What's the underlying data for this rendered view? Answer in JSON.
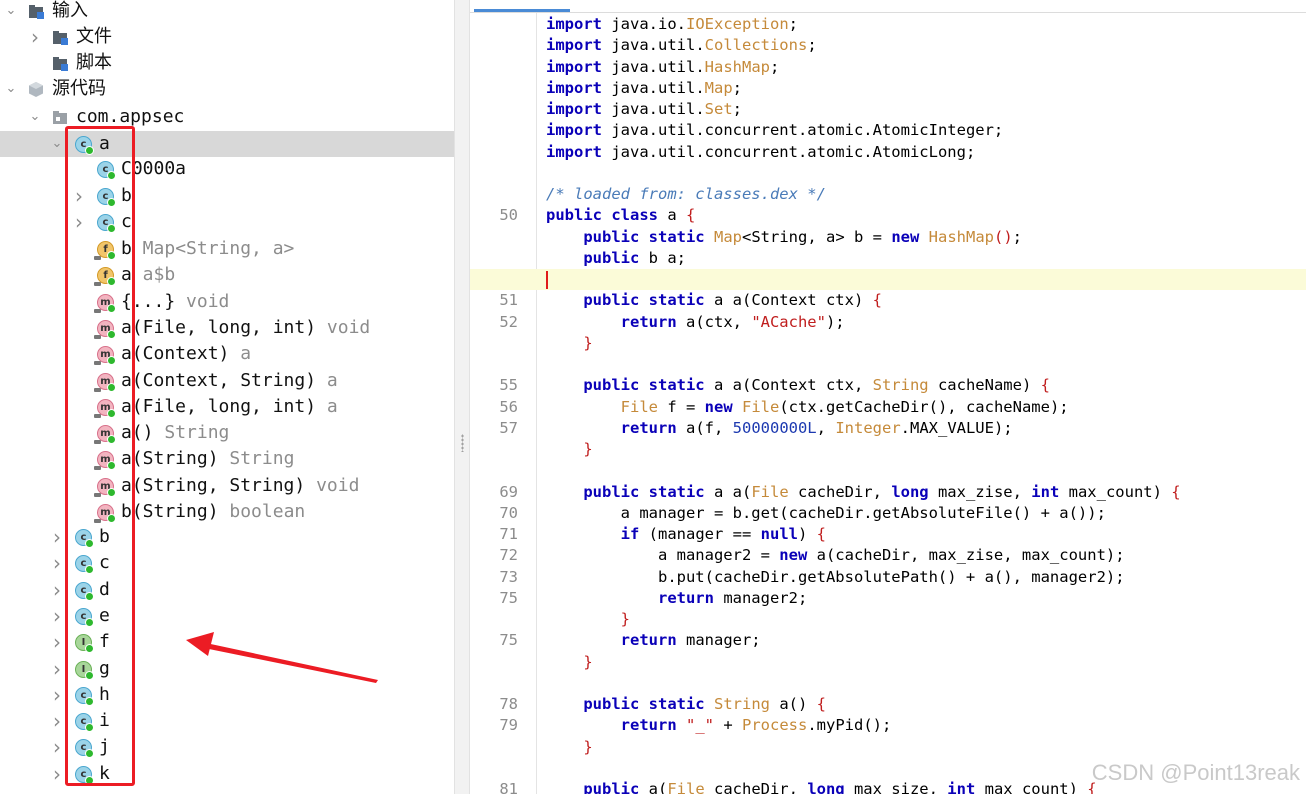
{
  "tree": {
    "input_label": "输入",
    "files_label": "文件",
    "scripts_label": "脚本",
    "source_label": "源代码",
    "package_label": "com.appsec",
    "selected_class": "a",
    "inner_class": "C0000a",
    "inner_b": "b",
    "inner_c": "c",
    "members": [
      {
        "name": "b",
        "detail": " Map<String, a>",
        "kind": "f"
      },
      {
        "name": "a",
        "detail": " a$b",
        "kind": "f"
      },
      {
        "name": "{...}",
        "detail": " void",
        "kind": "m"
      },
      {
        "name": "a(File, long, int)",
        "detail": " void",
        "kind": "m"
      },
      {
        "name": "a(Context)",
        "detail": " a",
        "kind": "m"
      },
      {
        "name": "a(Context, String)",
        "detail": " a",
        "kind": "m"
      },
      {
        "name": "a(File, long, int)",
        "detail": " a",
        "kind": "m"
      },
      {
        "name": "a()",
        "detail": " String",
        "kind": "m"
      },
      {
        "name": "a(String)",
        "detail": " String",
        "kind": "m"
      },
      {
        "name": "a(String, String)",
        "detail": " void",
        "kind": "m"
      },
      {
        "name": "b(String)",
        "detail": " boolean",
        "kind": "m"
      }
    ],
    "classes": [
      {
        "name": "b",
        "kind": "c"
      },
      {
        "name": "c",
        "kind": "c"
      },
      {
        "name": "d",
        "kind": "c"
      },
      {
        "name": "e",
        "kind": "c"
      },
      {
        "name": "f",
        "kind": "i"
      },
      {
        "name": "g",
        "kind": "i"
      },
      {
        "name": "h",
        "kind": "c"
      },
      {
        "name": "i",
        "kind": "c"
      },
      {
        "name": "j",
        "kind": "c"
      },
      {
        "name": "k",
        "kind": "c"
      }
    ]
  },
  "editor": {
    "lines": [
      {
        "n": "",
        "t": [
          [
            "kw",
            "import"
          ],
          [
            "pl",
            " java.io."
          ],
          [
            "ty",
            "IOException"
          ],
          [
            "pl",
            ";"
          ]
        ]
      },
      {
        "n": "",
        "t": [
          [
            "kw",
            "import"
          ],
          [
            "pl",
            " java.util."
          ],
          [
            "ty",
            "Collections"
          ],
          [
            "pl",
            ";"
          ]
        ]
      },
      {
        "n": "",
        "t": [
          [
            "kw",
            "import"
          ],
          [
            "pl",
            " java.util."
          ],
          [
            "ty",
            "HashMap"
          ],
          [
            "pl",
            ";"
          ]
        ]
      },
      {
        "n": "",
        "t": [
          [
            "kw",
            "import"
          ],
          [
            "pl",
            " java.util."
          ],
          [
            "ty",
            "Map"
          ],
          [
            "pl",
            ";"
          ]
        ]
      },
      {
        "n": "",
        "t": [
          [
            "kw",
            "import"
          ],
          [
            "pl",
            " java.util."
          ],
          [
            "ty",
            "Set"
          ],
          [
            "pl",
            ";"
          ]
        ]
      },
      {
        "n": "",
        "t": [
          [
            "kw",
            "import"
          ],
          [
            "pl",
            " java.util.concurrent.atomic.AtomicInteger;"
          ]
        ]
      },
      {
        "n": "",
        "t": [
          [
            "kw",
            "import"
          ],
          [
            "pl",
            " java.util.concurrent.atomic.AtomicLong;"
          ]
        ]
      },
      {
        "n": "",
        "t": []
      },
      {
        "n": "",
        "t": [
          [
            "cm",
            "/* loaded from: classes.dex */"
          ]
        ]
      },
      {
        "n": "50",
        "t": [
          [
            "kw",
            "public class"
          ],
          [
            "pl",
            " a "
          ],
          [
            "pa",
            "{"
          ]
        ]
      },
      {
        "n": "",
        "t": [
          [
            "pl",
            "    "
          ],
          [
            "kw",
            "public static"
          ],
          [
            "pl",
            " "
          ],
          [
            "ty",
            "Map"
          ],
          [
            "pl",
            "<String, a> b = "
          ],
          [
            "kw",
            "new"
          ],
          [
            "pl",
            " "
          ],
          [
            "ty",
            "HashMap"
          ],
          [
            "pa",
            "()"
          ],
          [
            "pl",
            ";"
          ]
        ]
      },
      {
        "n": "",
        "t": [
          [
            "pl",
            "    "
          ],
          [
            "kw",
            "public"
          ],
          [
            "pl",
            " b a;"
          ]
        ]
      },
      {
        "n": "",
        "t": [],
        "cur": true
      },
      {
        "n": "51",
        "t": [
          [
            "pl",
            "    "
          ],
          [
            "kw",
            "public static"
          ],
          [
            "pl",
            " a a(Context ctx) "
          ],
          [
            "pa",
            "{"
          ]
        ]
      },
      {
        "n": "52",
        "t": [
          [
            "pl",
            "        "
          ],
          [
            "kw",
            "return"
          ],
          [
            "pl",
            " a(ctx, "
          ],
          [
            "st",
            "\"ACache\""
          ],
          [
            "pl",
            ");"
          ]
        ]
      },
      {
        "n": "",
        "t": [
          [
            "pl",
            "    "
          ],
          [
            "pa",
            "}"
          ]
        ]
      },
      {
        "n": "",
        "t": []
      },
      {
        "n": "55",
        "t": [
          [
            "pl",
            "    "
          ],
          [
            "kw",
            "public static"
          ],
          [
            "pl",
            " a a(Context ctx, "
          ],
          [
            "ty",
            "String"
          ],
          [
            "pl",
            " cacheName) "
          ],
          [
            "pa",
            "{"
          ]
        ]
      },
      {
        "n": "56",
        "t": [
          [
            "pl",
            "        "
          ],
          [
            "ty",
            "File"
          ],
          [
            "pl",
            " f = "
          ],
          [
            "kw",
            "new"
          ],
          [
            "pl",
            " "
          ],
          [
            "ty",
            "File"
          ],
          [
            "pl",
            "(ctx.getCacheDir(), cacheName);"
          ]
        ]
      },
      {
        "n": "57",
        "t": [
          [
            "pl",
            "        "
          ],
          [
            "kw",
            "return"
          ],
          [
            "pl",
            " a(f, "
          ],
          [
            "nm",
            "50000000L"
          ],
          [
            "pl",
            ", "
          ],
          [
            "ty",
            "Integer"
          ],
          [
            "pl",
            ".MAX_VALUE);"
          ]
        ]
      },
      {
        "n": "",
        "t": [
          [
            "pl",
            "    "
          ],
          [
            "pa",
            "}"
          ]
        ]
      },
      {
        "n": "",
        "t": []
      },
      {
        "n": "69",
        "t": [
          [
            "pl",
            "    "
          ],
          [
            "kw",
            "public static"
          ],
          [
            "pl",
            " a a("
          ],
          [
            "ty",
            "File"
          ],
          [
            "pl",
            " cacheDir, "
          ],
          [
            "kw",
            "long"
          ],
          [
            "pl",
            " max_zise, "
          ],
          [
            "kw",
            "int"
          ],
          [
            "pl",
            " max_count) "
          ],
          [
            "pa",
            "{"
          ]
        ]
      },
      {
        "n": "70",
        "t": [
          [
            "pl",
            "        a manager = b.get(cacheDir.getAbsoluteFile() + a());"
          ]
        ]
      },
      {
        "n": "71",
        "t": [
          [
            "pl",
            "        "
          ],
          [
            "kw",
            "if"
          ],
          [
            "pl",
            " (manager == "
          ],
          [
            "kw",
            "null"
          ],
          [
            "pl",
            ") "
          ],
          [
            "pa",
            "{"
          ]
        ]
      },
      {
        "n": "72",
        "t": [
          [
            "pl",
            "            a manager2 = "
          ],
          [
            "kw",
            "new"
          ],
          [
            "pl",
            " a(cacheDir, max_zise, max_count);"
          ]
        ]
      },
      {
        "n": "73",
        "t": [
          [
            "pl",
            "            b.put(cacheDir.getAbsolutePath() + a(), manager2);"
          ]
        ]
      },
      {
        "n": "75",
        "t": [
          [
            "pl",
            "            "
          ],
          [
            "kw",
            "return"
          ],
          [
            "pl",
            " manager2;"
          ]
        ]
      },
      {
        "n": "",
        "t": [
          [
            "pl",
            "        "
          ],
          [
            "pa",
            "}"
          ]
        ]
      },
      {
        "n": "75",
        "t": [
          [
            "pl",
            "        "
          ],
          [
            "kw",
            "return"
          ],
          [
            "pl",
            " manager;"
          ]
        ]
      },
      {
        "n": "",
        "t": [
          [
            "pl",
            "    "
          ],
          [
            "pa",
            "}"
          ]
        ]
      },
      {
        "n": "",
        "t": []
      },
      {
        "n": "78",
        "t": [
          [
            "pl",
            "    "
          ],
          [
            "kw",
            "public static"
          ],
          [
            "pl",
            " "
          ],
          [
            "ty",
            "String"
          ],
          [
            "pl",
            " a() "
          ],
          [
            "pa",
            "{"
          ]
        ]
      },
      {
        "n": "79",
        "t": [
          [
            "pl",
            "        "
          ],
          [
            "kw",
            "return"
          ],
          [
            "pl",
            " "
          ],
          [
            "st",
            "\"_\""
          ],
          [
            "pl",
            " + "
          ],
          [
            "ty",
            "Process"
          ],
          [
            "pl",
            ".myPid();"
          ]
        ]
      },
      {
        "n": "",
        "t": [
          [
            "pl",
            "    "
          ],
          [
            "pa",
            "}"
          ]
        ]
      },
      {
        "n": "",
        "t": []
      },
      {
        "n": "81",
        "t": [
          [
            "pl",
            "    "
          ],
          [
            "kw",
            "public"
          ],
          [
            "pl",
            " a("
          ],
          [
            "ty",
            "File"
          ],
          [
            "pl",
            " cacheDir, "
          ],
          [
            "kw",
            "long"
          ],
          [
            "pl",
            " max_size, "
          ],
          [
            "kw",
            "int"
          ],
          [
            "pl",
            " max_count) "
          ],
          [
            "pa",
            "{"
          ]
        ]
      }
    ]
  },
  "watermark": "CSDN @Point13reak",
  "colors": {
    "annotation": "#ec1c24",
    "keyword": "#0a00b8",
    "type": "#c58a3a",
    "string": "#c01e1e"
  }
}
